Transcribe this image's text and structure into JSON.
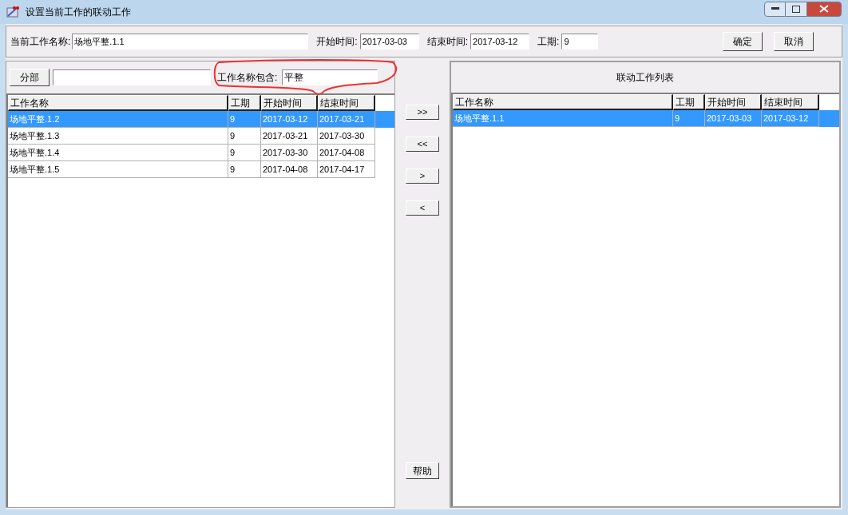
{
  "window": {
    "title": "设置当前工作的联动工作"
  },
  "header": {
    "fields": [
      {
        "label": "当前工作名称:",
        "value": "场地平整.1.1",
        "kind": "wide"
      },
      {
        "label": "开始时间:",
        "value": "2017-03-03",
        "kind": "date"
      },
      {
        "label": "结束时间:",
        "value": "2017-03-12",
        "kind": "date"
      },
      {
        "label": "工期:",
        "value": "9",
        "kind": "short"
      }
    ],
    "buttons": [
      "确定",
      "取消"
    ]
  },
  "left": {
    "dept_button": "分部",
    "filter": {
      "label": "工作名称包含:",
      "value": "平整"
    },
    "table": {
      "columns": [
        "工作名称",
        "工期",
        "开始时间",
        "结束时间"
      ],
      "rows": [
        {
          "cells": [
            "场地平整.1.2",
            "9",
            "2017-03-12",
            "2017-03-21"
          ],
          "selected": true
        },
        {
          "cells": [
            "场地平整.1.3",
            "9",
            "2017-03-21",
            "2017-03-30"
          ],
          "selected": false
        },
        {
          "cells": [
            "场地平整.1.4",
            "9",
            "2017-03-30",
            "2017-04-08"
          ],
          "selected": false
        },
        {
          "cells": [
            "场地平整.1.5",
            "9",
            "2017-04-08",
            "2017-04-17"
          ],
          "selected": false
        }
      ]
    }
  },
  "middle": {
    "buttons": [
      ">>",
      "<<",
      ">",
      "<"
    ],
    "help": "帮助"
  },
  "right": {
    "title": "联动工作列表",
    "table": {
      "columns": [
        "工作名称",
        "工期",
        "开始时间",
        "结束时间"
      ],
      "rows": [
        {
          "cells": [
            "场地平整.1.1",
            "9",
            "2017-03-03",
            "2017-03-12"
          ],
          "selected": true
        }
      ]
    }
  }
}
